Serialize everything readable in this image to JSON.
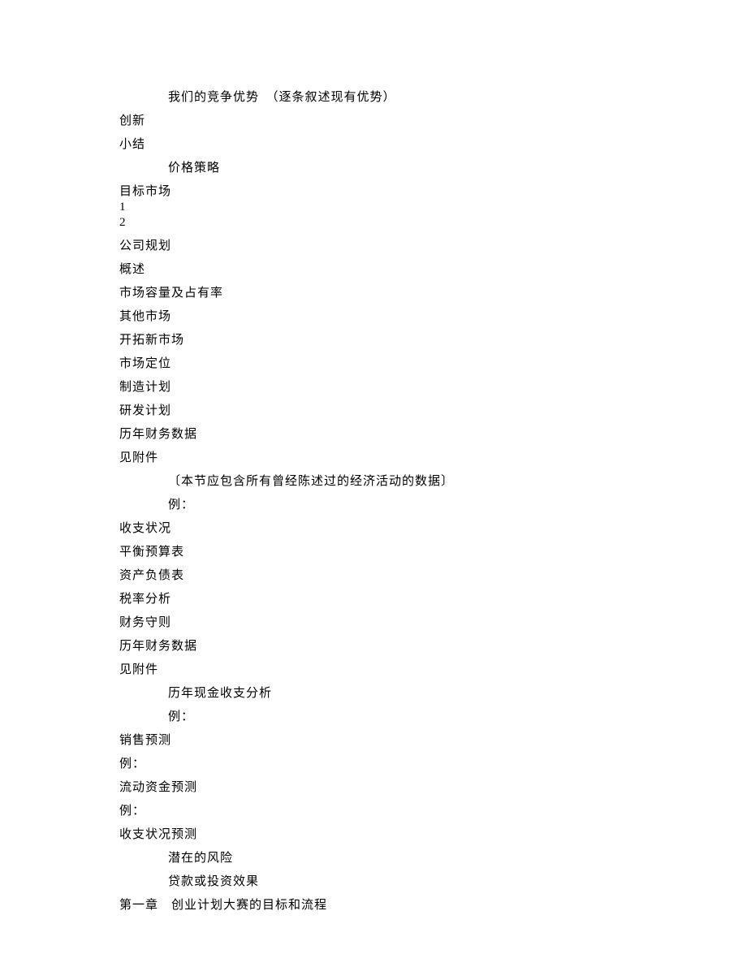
{
  "lines": [
    {
      "text": "我们的竞争优势　（逐条叙述现有优势）",
      "indent": true,
      "tight": false
    },
    {
      "text": "创新",
      "indent": false,
      "tight": false
    },
    {
      "text": "小结",
      "indent": false,
      "tight": false
    },
    {
      "text": "价格策略",
      "indent": true,
      "tight": false
    },
    {
      "text": "目标市场",
      "indent": false,
      "tight": true
    },
    {
      "text": "1",
      "indent": false,
      "tight": true
    },
    {
      "text": "2",
      "indent": false,
      "tight": false
    },
    {
      "text": "公司规划",
      "indent": false,
      "tight": false
    },
    {
      "text": "概述",
      "indent": false,
      "tight": false
    },
    {
      "text": "市场容量及占有率",
      "indent": false,
      "tight": false
    },
    {
      "text": "其他市场",
      "indent": false,
      "tight": false
    },
    {
      "text": "开拓新市场",
      "indent": false,
      "tight": false
    },
    {
      "text": "市场定位",
      "indent": false,
      "tight": false
    },
    {
      "text": "制造计划",
      "indent": false,
      "tight": false
    },
    {
      "text": "研发计划",
      "indent": false,
      "tight": false
    },
    {
      "text": "历年财务数据",
      "indent": false,
      "tight": false
    },
    {
      "text": "见附件",
      "indent": false,
      "tight": false
    },
    {
      "text": "〔本节应包含所有曾经陈述过的经济活动的数据〕",
      "indent": true,
      "tight": false
    },
    {
      "text": "例：",
      "indent": true,
      "tight": false
    },
    {
      "text": "收支状况",
      "indent": false,
      "tight": false
    },
    {
      "text": "平衡预算表",
      "indent": false,
      "tight": false
    },
    {
      "text": "资产负债表",
      "indent": false,
      "tight": false
    },
    {
      "text": "税率分析",
      "indent": false,
      "tight": false
    },
    {
      "text": "财务守则",
      "indent": false,
      "tight": false
    },
    {
      "text": "历年财务数据",
      "indent": false,
      "tight": false
    },
    {
      "text": "见附件",
      "indent": false,
      "tight": false
    },
    {
      "text": "历年现金收支分析",
      "indent": true,
      "tight": false
    },
    {
      "text": "例：",
      "indent": true,
      "tight": false
    },
    {
      "text": "销售预测",
      "indent": false,
      "tight": false
    },
    {
      "text": "例：",
      "indent": false,
      "tight": false
    },
    {
      "text": "流动资金预测",
      "indent": false,
      "tight": false
    },
    {
      "text": "例：",
      "indent": false,
      "tight": false
    },
    {
      "text": "收支状况预测",
      "indent": false,
      "tight": false
    },
    {
      "text": "潜在的风险",
      "indent": true,
      "tight": false
    },
    {
      "text": "贷款或投资效果",
      "indent": true,
      "tight": false
    },
    {
      "text": "第一章　创业计划大赛的目标和流程",
      "indent": false,
      "tight": false
    }
  ]
}
